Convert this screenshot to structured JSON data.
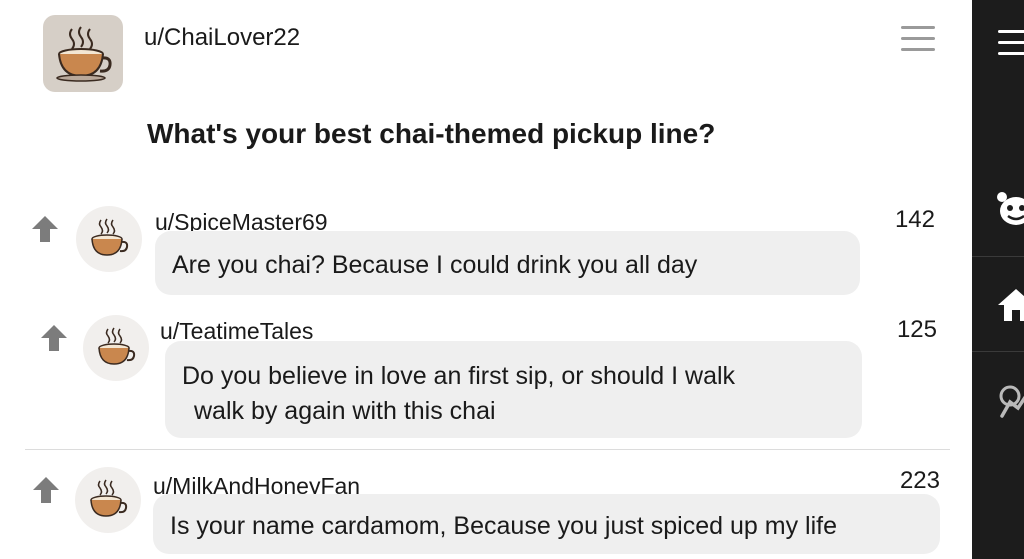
{
  "post": {
    "author": "u/ChaiLover22",
    "title": "What's your best chai-themed pickup line?"
  },
  "comments": [
    {
      "user": "u/SpiceMaster69",
      "score": "142",
      "text": "Are you chai? Because I could drink you all day"
    },
    {
      "user": "u/TeatimeTales",
      "score": "125",
      "text_line1": "Do you believe in love an first sip, or should I walk",
      "text_line2": "walk by again with this chai"
    },
    {
      "user": "u/MilkAndHoneyFan",
      "score": "223",
      "text": "Is your name cardamom, Because you just spiced up my life"
    }
  ],
  "icons": {
    "menu": "hamburger-menu-icon",
    "upvote": "upvote-arrow-icon",
    "avatar": "chai-cup-icon",
    "rail": [
      "hamburger-menu-icon",
      "snoo-face-icon",
      "home-icon",
      "popular-icon"
    ]
  },
  "colors": {
    "background": "#ffffff",
    "bubble": "#efefef",
    "upvote_arrow": "#7c7c7c",
    "rail": "#1c1c1c",
    "cup": "#c9874e"
  }
}
